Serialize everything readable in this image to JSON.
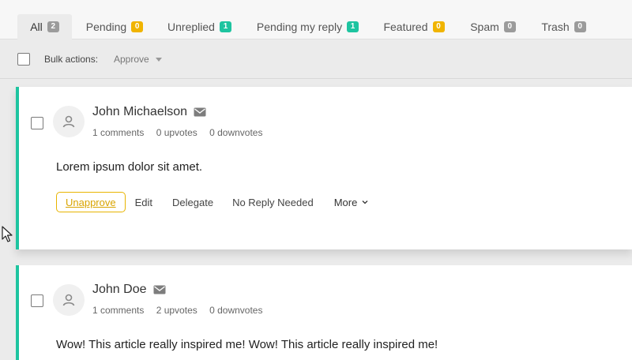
{
  "tabs": [
    {
      "label": "All",
      "count": "2",
      "color": "#9b9b9b"
    },
    {
      "label": "Pending",
      "count": "0",
      "color": "#f0b400"
    },
    {
      "label": "Unreplied",
      "count": "1",
      "color": "#1ec4a0"
    },
    {
      "label": "Pending my reply",
      "count": "1",
      "color": "#1ec4a0"
    },
    {
      "label": "Featured",
      "count": "0",
      "color": "#f0b400"
    },
    {
      "label": "Spam",
      "count": "0",
      "color": "#9b9b9b"
    },
    {
      "label": "Trash",
      "count": "0",
      "color": "#9b9b9b"
    }
  ],
  "bulk": {
    "label": "Bulk actions:",
    "selected": "Approve"
  },
  "comments": [
    {
      "author": "John Michaelson",
      "comments": "1 comments",
      "upvotes": "0 upvotes",
      "downvotes": "0 downvotes",
      "text": "Lorem ipsum dolor sit amet.",
      "actions": {
        "unapprove": "Unapprove",
        "edit": "Edit",
        "delegate": "Delegate",
        "no_reply": "No Reply Needed",
        "more": "More"
      }
    },
    {
      "author": "John Doe",
      "comments": "1 comments",
      "upvotes": "2 upvotes",
      "downvotes": "0 downvotes",
      "text": "Wow! This article really inspired me! Wow! This article really inspired me!"
    }
  ],
  "colors": {
    "accent": "#1ec4a0",
    "pending": "#f0b400",
    "neutral": "#9b9b9b"
  }
}
